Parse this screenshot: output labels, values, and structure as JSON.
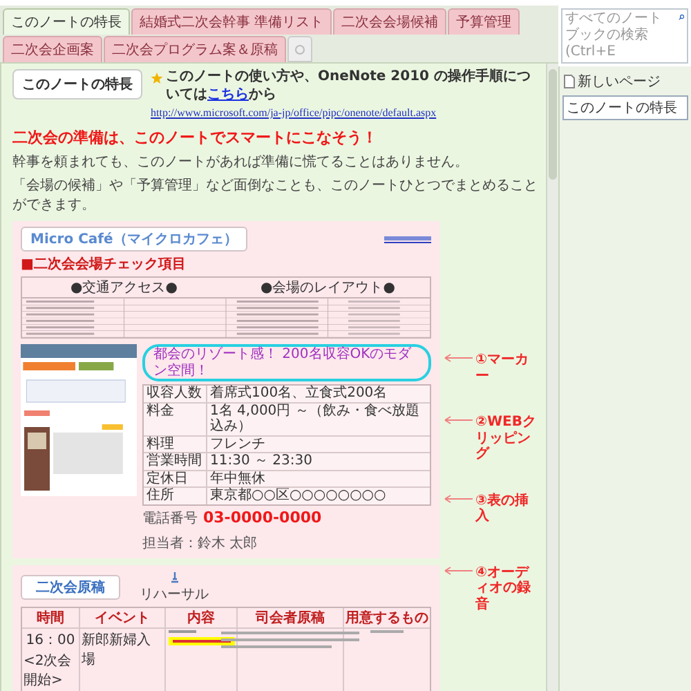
{
  "tabs": [
    {
      "label": "このノートの特長",
      "selected": true
    },
    {
      "label": "結婚式二次会幹事 準備リスト",
      "selected": false
    },
    {
      "label": "二次会会場候補",
      "selected": false
    },
    {
      "label": "予算管理",
      "selected": false
    },
    {
      "label": "二次会企画案",
      "selected": false
    },
    {
      "label": "二次会プログラム案＆原稿",
      "selected": false
    }
  ],
  "search": {
    "placeholder": "すべてのノートブックの検索 (Ctrl+E"
  },
  "pages_panel": {
    "new_page": "新しいページ",
    "pages": [
      {
        "title": "このノートの特長",
        "selected": true
      }
    ]
  },
  "page": {
    "title": "このノートの特長",
    "intro": "このノートの使い方や、OneNote 2010 の操作手順については",
    "intro_link": "こちら",
    "intro_end": "から",
    "url": "http://www.microsoft.com/ja-jp/office/pipc/onenote/default.aspx",
    "headline": "二次会の準備は、このノートでスマートにこなそう！",
    "paragraphs": [
      "幹事を頼まれても、このノートがあれば準備に慌てることはありません。",
      "「会場の候補」や「予算管理」など面倒なことも、このノートひとつでまとめることができます。"
    ]
  },
  "venue_sample": {
    "name": "Micro Café（マイクロカフェ）",
    "section": "■二次会会場チェック項目",
    "checklist_headers": [
      "●交通アクセス●",
      "●会場のレイアウト●"
    ],
    "marker_text": "都会のリゾート感！ 200名収容OKのモダン空間！",
    "info": [
      {
        "label": "収容人数",
        "value": "着席式100名、立食式200名"
      },
      {
        "label": "料金",
        "value": "1名 4,000円 ～（飲み・食べ放題込み）"
      },
      {
        "label": "料理",
        "value": "フレンチ"
      },
      {
        "label": "営業時間",
        "value": "11:30 ～ 23:30"
      },
      {
        "label": "定休日",
        "value": "年中無休"
      },
      {
        "label": "住所",
        "value": "東京都○○区○○○○○○○○"
      }
    ],
    "phone_label": "電話番号",
    "phone": "03-0000-0000",
    "contact": "担当者：鈴木 太郎"
  },
  "annotations": [
    "①マーカー",
    "②WEBクリッピング",
    "③表の挿入",
    "④オーディオの録音"
  ],
  "script_section": {
    "title": "二次会原稿",
    "audio_label": "リハーサル",
    "columns": [
      "時間",
      "イベント",
      "内容",
      "司会者原稿",
      "用意するもの"
    ],
    "rows": [
      {
        "time": "16：00",
        "note": "<2次会開始>",
        "event": "新郎新婦入場"
      }
    ]
  }
}
